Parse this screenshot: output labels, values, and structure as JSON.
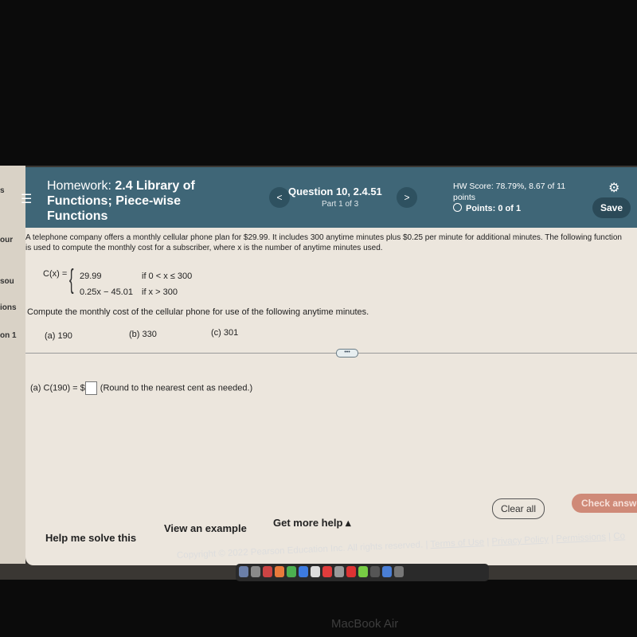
{
  "sidebar_fragments": [
    "s",
    "our",
    "sou",
    "ions",
    "on 1"
  ],
  "header": {
    "homework_label": "Homework:",
    "homework_title": "2.4 Library of Functions; Piece-wise Functions",
    "prev": "<",
    "next": ">",
    "question": "Question 10, 2.4.51",
    "part": "Part 1 of 3",
    "hw_score": "HW Score: 78.79%, 8.67 of 11 points",
    "points": "Points: 0 of 1",
    "save": "Save"
  },
  "problem": {
    "text": "A telephone company offers a monthly cellular phone plan for $29.99. It includes 300 anytime minutes plus $0.25 per minute for additional minutes. The following function is used to compute the monthly cost for a subscriber, where x is the number of anytime minutes used.",
    "function_name": "C(x) =",
    "cases": [
      {
        "expr": "29.99",
        "cond": "if 0 < x ≤ 300"
      },
      {
        "expr": "0.25x − 45.01",
        "cond": "if x > 300"
      }
    ],
    "instruction": "Compute the monthly cost of the cellular phone for use of the following anytime minutes.",
    "parts": [
      "(a) 190",
      "(b) 330",
      "(c) 301"
    ],
    "more": "•••",
    "answer_prefix": "(a) C(190) = $",
    "answer_value": "",
    "answer_hint": "(Round to the nearest cent as needed.)"
  },
  "actions": {
    "help_me": "Help me solve this",
    "example": "View an example",
    "more_help": "Get more help ▴",
    "clear": "Clear all",
    "check": "Check answer"
  },
  "footer": {
    "copyright": "Copyright © 2022 Pearson Education Inc. All rights reserved. |",
    "links": [
      "Terms of Use",
      "Privacy Policy",
      "Permissions",
      "Co"
    ]
  },
  "device_label": "MacBook Air",
  "colors": {
    "header": "#3f6677",
    "check": "#cf8a78",
    "content": "#ece6dd"
  }
}
